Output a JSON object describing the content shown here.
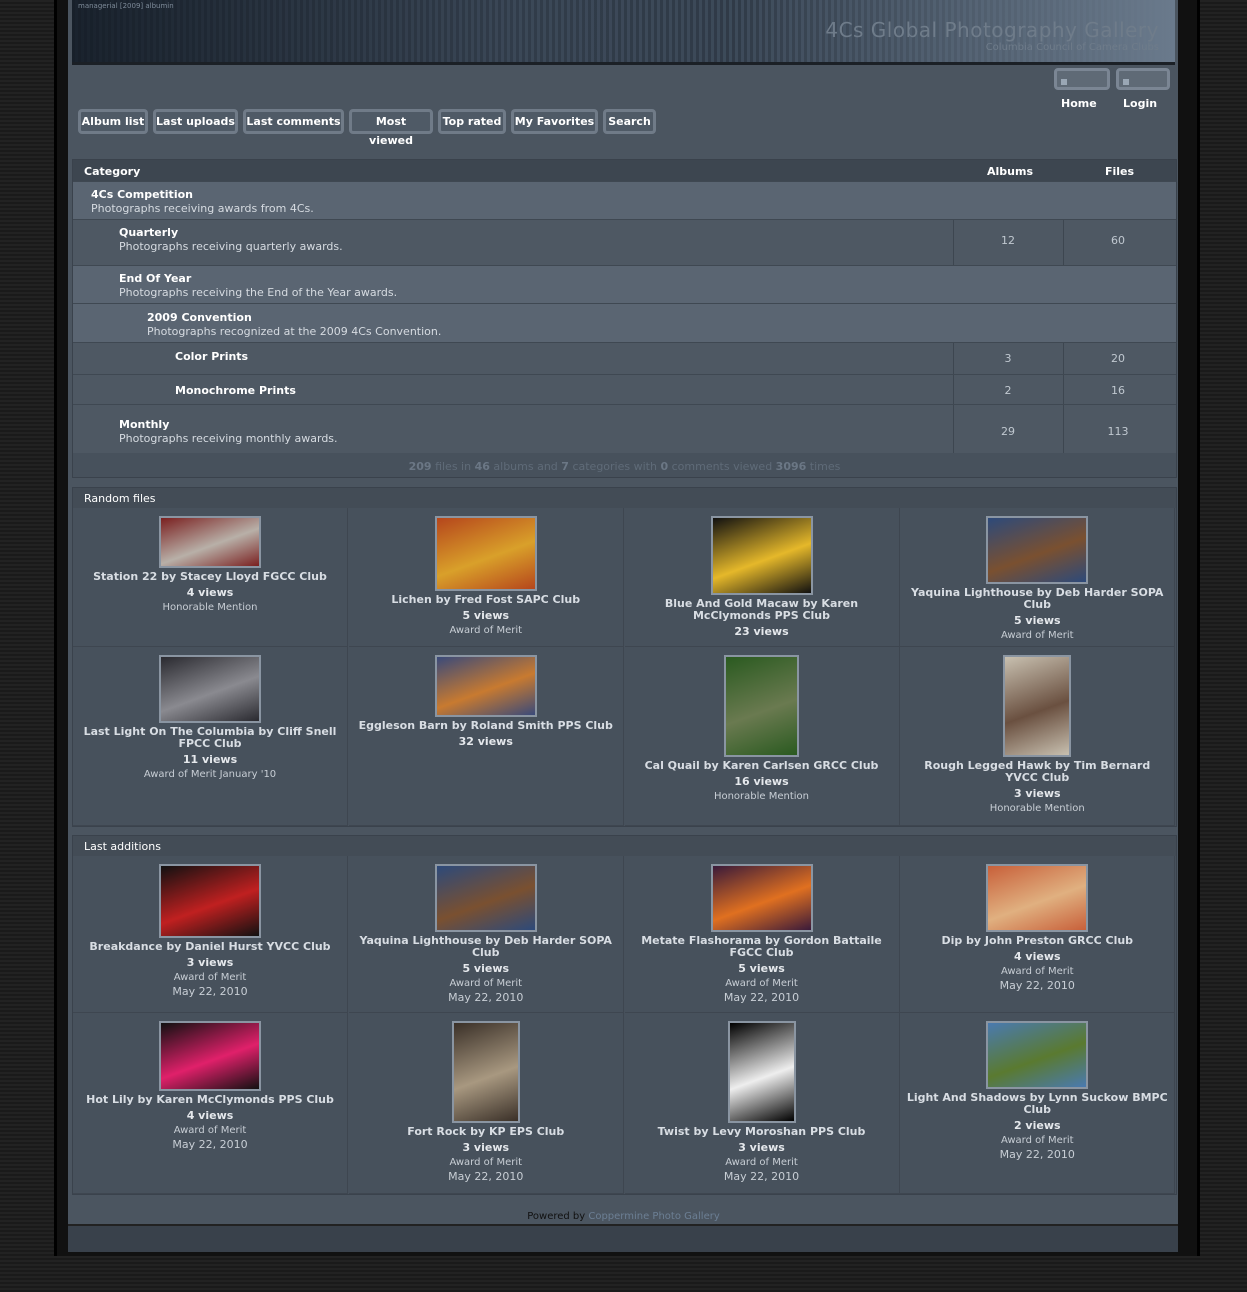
{
  "banner": {
    "tag": "managerial [2009] albumin",
    "title": "4Cs Global Photography Gallery",
    "subtitle": "Columbia Council of Camera Clubs"
  },
  "top_nav": {
    "home": "Home",
    "login": "Login"
  },
  "nav": [
    "Album list",
    "Last uploads",
    "Last comments",
    "Most viewed",
    "Top rated",
    "My Favorites",
    "Search"
  ],
  "categories": {
    "headers": {
      "category": "Category",
      "albums": "Albums",
      "files": "Files"
    },
    "rows": [
      {
        "name": "4Cs Competition",
        "desc": "Photographs receiving awards from 4Cs.",
        "albums": "",
        "files": ""
      },
      {
        "name": "Quarterly",
        "desc": "Photographs receiving quarterly awards.",
        "albums": "12",
        "files": "60"
      },
      {
        "name": "End Of Year",
        "desc": "Photographs receiving the End of the Year awards.",
        "albums": "",
        "files": ""
      },
      {
        "name": "2009 Convention",
        "desc": "Photographs recognized at the 2009 4Cs Convention.",
        "albums": "",
        "files": ""
      },
      {
        "name": "Color Prints",
        "desc": "",
        "albums": "3",
        "files": "20"
      },
      {
        "name": "Monochrome Prints",
        "desc": "",
        "albums": "2",
        "files": "16"
      },
      {
        "name": "Monthly",
        "desc": "Photographs receiving monthly awards.",
        "albums": "29",
        "files": "113"
      }
    ],
    "stats": {
      "files": "209",
      "t1": " files in ",
      "albums": "46",
      "t2": " albums and ",
      "cats": "7",
      "t3": " categories with ",
      "comments": "0",
      "t4": " comments viewed ",
      "views": "3096",
      "t5": " times"
    }
  },
  "random_files": {
    "title": "Random files",
    "items": [
      {
        "title": "Station 22 by Stacey Lloyd FGCC Club",
        "views": "4 views",
        "note": "Honorable Mention",
        "colors": [
          "#7a2020",
          "#b8b0a8"
        ]
      },
      {
        "title": "Lichen by Fred Fost SAPC Club",
        "views": "5 views",
        "note": "Award of Merit",
        "colors": [
          "#b5461c",
          "#d9a02a"
        ]
      },
      {
        "title": "Blue And Gold Macaw by Karen McClymonds PPS Club",
        "views": "23 views",
        "note": "",
        "colors": [
          "#111",
          "#e5b82a"
        ]
      },
      {
        "title": "Yaquina Lighthouse by Deb Harder SOPA Club",
        "views": "5 views",
        "note": "Award of Merit",
        "colors": [
          "#2d4a7a",
          "#7a5030"
        ]
      },
      {
        "title": "Last Light On The Columbia by Cliff Snell FPCC Club",
        "views": "11 views",
        "note": "Award of Merit January '10",
        "colors": [
          "#2a2a30",
          "#8a8a90"
        ]
      },
      {
        "title": "Eggleson Barn by Roland Smith PPS Club",
        "views": "32 views",
        "note": "",
        "colors": [
          "#3a4a7a",
          "#c87a30"
        ]
      },
      {
        "title": "Cal Quail by Karen Carlsen GRCC Club",
        "views": "16 views",
        "note": "Honorable Mention",
        "colors": [
          "#2a5a20",
          "#6a7a50"
        ]
      },
      {
        "title": "Rough Legged Hawk by Tim Bernard YVCC Club",
        "views": "3 views",
        "note": "Honorable Mention",
        "colors": [
          "#c8c0b0",
          "#6a5040"
        ]
      }
    ]
  },
  "last_additions": {
    "title": "Last additions",
    "items": [
      {
        "title": "Breakdance by Daniel Hurst YVCC Club",
        "views": "3 views",
        "note": "Award of Merit",
        "date": "May 22, 2010",
        "colors": [
          "#111",
          "#c02020"
        ]
      },
      {
        "title": "Yaquina Lighthouse by Deb Harder SOPA Club",
        "views": "5 views",
        "note": "Award of Merit",
        "date": "May 22, 2010",
        "colors": [
          "#2d4a7a",
          "#7a5030"
        ]
      },
      {
        "title": "Metate Flashorama by Gordon Battaile FGCC Club",
        "views": "5 views",
        "note": "Award of Merit",
        "date": "May 22, 2010",
        "colors": [
          "#3a1a3a",
          "#e07020"
        ]
      },
      {
        "title": "Dip by John Preston GRCC Club",
        "views": "4 views",
        "note": "Award of Merit",
        "date": "May 22, 2010",
        "colors": [
          "#c8603a",
          "#e0b080"
        ]
      },
      {
        "title": "Hot Lily by Karen McClymonds PPS Club",
        "views": "4 views",
        "note": "Award of Merit",
        "date": "May 22, 2010",
        "colors": [
          "#111",
          "#e0206a"
        ]
      },
      {
        "title": "Fort Rock by KP EPS Club",
        "views": "3 views",
        "note": "Award of Merit",
        "date": "May 22, 2010",
        "colors": [
          "#3a3028",
          "#a89880"
        ]
      },
      {
        "title": "Twist by Levy Moroshan PPS Club",
        "views": "3 views",
        "note": "Award of Merit",
        "date": "May 22, 2010",
        "colors": [
          "#000",
          "#eee"
        ]
      },
      {
        "title": "Light And Shadows by Lynn Suckow BMPC Club",
        "views": "2 views",
        "note": "Award of Merit",
        "date": "May 22, 2010",
        "colors": [
          "#4a7ab0",
          "#5a7a30"
        ]
      }
    ]
  },
  "footer": {
    "prefix": "Powered by ",
    "link": "Coppermine Photo Gallery"
  }
}
